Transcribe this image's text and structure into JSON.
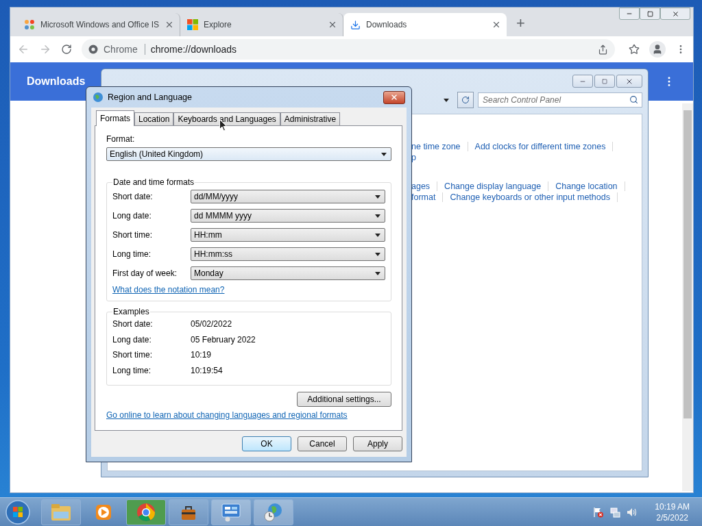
{
  "browser": {
    "tabs": [
      {
        "title": "Microsoft Windows and Office IS",
        "kind": "joomla",
        "selected": false
      },
      {
        "title": "Explore",
        "kind": "windows",
        "selected": false
      },
      {
        "title": "Downloads",
        "kind": "download",
        "selected": true
      }
    ],
    "new_tab": "+",
    "omnibox": {
      "chip": "Chrome",
      "url": "chrome://downloads"
    },
    "page": {
      "title": "Downloads"
    }
  },
  "control_panel": {
    "search": {
      "placeholder": "Search Control Panel"
    },
    "link_groups": [
      [
        [
          "ne time zone",
          "Add clocks for different time zones"
        ],
        [
          "p"
        ]
      ],
      [
        [
          "ages",
          "Change display language",
          "Change location"
        ],
        [
          "format",
          "Change keyboards or other input methods"
        ]
      ]
    ]
  },
  "dialog": {
    "title": "Region and Language",
    "tabs": [
      {
        "label": "Formats",
        "selected": true
      },
      {
        "label": "Location",
        "selected": false
      },
      {
        "label": "Keyboards and Languages",
        "selected": false
      },
      {
        "label": "Administrative",
        "selected": false
      }
    ],
    "format": {
      "label": "Format:",
      "value": "English (United Kingdom)"
    },
    "date_time_formats": {
      "title": "Date and time formats",
      "rows": [
        {
          "label": "Short date:",
          "value": "dd/MM/yyyy"
        },
        {
          "label": "Long date:",
          "value": "dd MMMM yyyy"
        },
        {
          "label": "Short time:",
          "value": "HH:mm"
        },
        {
          "label": "Long time:",
          "value": "HH:mm:ss"
        },
        {
          "label": "First day of week:",
          "value": "Monday"
        }
      ],
      "link": "What does the notation mean?"
    },
    "examples": {
      "title": "Examples",
      "rows": [
        {
          "label": "Short date:",
          "value": "05/02/2022"
        },
        {
          "label": "Long date:",
          "value": "05 February 2022"
        },
        {
          "label": "Short time:",
          "value": "10:19"
        },
        {
          "label": "Long time:",
          "value": "10:19:54"
        }
      ]
    },
    "additional_button": "Additional settings...",
    "online_link": "Go online to learn about changing languages and regional formats",
    "buttons": [
      {
        "label": "OK",
        "default": true
      },
      {
        "label": "Cancel",
        "default": false
      },
      {
        "label": "Apply",
        "default": false
      }
    ]
  },
  "taskbar": {
    "time": "10:19 AM",
    "date": "2/5/2022"
  }
}
